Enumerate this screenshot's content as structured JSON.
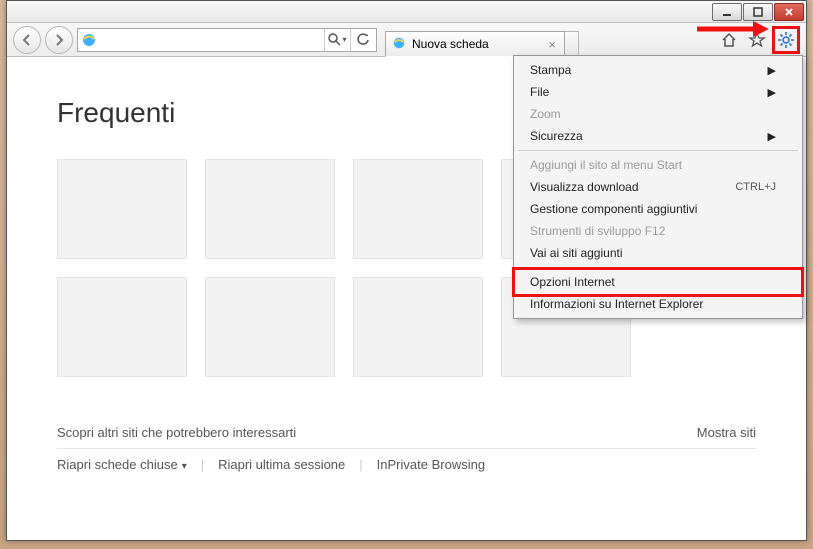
{
  "titlebar": {},
  "nav": {
    "address": "",
    "tab_label": "Nuova scheda"
  },
  "page": {
    "heading": "Frequenti",
    "discover": "Scopri altri siti che potrebbero interessarti",
    "show_sites": "Mostra siti",
    "reopen_closed": "Riapri schede chiuse",
    "reopen_last": "Riapri ultima sessione",
    "inprivate": "InPrivate Browsing"
  },
  "menu": {
    "items": [
      {
        "label": "Stampa",
        "submenu": true
      },
      {
        "label": "File",
        "submenu": true
      },
      {
        "label": "Zoom",
        "disabled": true
      },
      {
        "label": "Sicurezza",
        "submenu": true
      },
      {
        "sep": true
      },
      {
        "label": "Aggiungi il sito al menu Start",
        "disabled": true
      },
      {
        "label": "Visualizza download",
        "shortcut": "CTRL+J"
      },
      {
        "label": "Gestione componenti aggiuntivi"
      },
      {
        "label": "Strumenti di sviluppo F12",
        "disabled": true
      },
      {
        "label": "Vai ai siti aggiunti"
      },
      {
        "sep": true
      },
      {
        "label": "Opzioni Internet",
        "highlight": true
      },
      {
        "label": "Informazioni su Internet Explorer"
      }
    ]
  }
}
